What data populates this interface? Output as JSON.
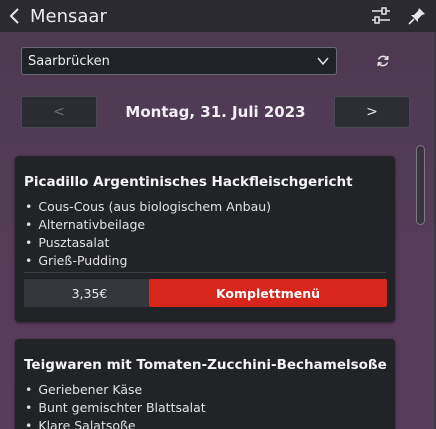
{
  "header": {
    "title": "Mensaar",
    "icons": [
      "chevron-left-icon",
      "sliders-icon",
      "pin-icon"
    ]
  },
  "location": {
    "selected": "Saarbrücken",
    "refresh_icon": "refresh-icon"
  },
  "date_nav": {
    "prev_label": "<",
    "next_label": ">",
    "date": "Montag, 31. Juli 2023"
  },
  "meals": [
    {
      "title": "Picadillo Argentinisches Hackfleischgericht",
      "components": [
        "Cous-Cous (aus biologischem Anbau)",
        "Alternativbeilage",
        "Pusztasalat",
        "Grieß-Pudding"
      ],
      "price": "3,35€",
      "badge": "Komplettmenü",
      "badge_color": "#d9261c"
    },
    {
      "title": "Teigwaren mit Tomaten-Zucchini-Bechamelsoße",
      "components": [
        "Geriebener Käse",
        "Bunt gemischter Blattsalat",
        "Klare Salatsoße"
      ]
    }
  ],
  "colors": {
    "titlebar": "#2b2a31",
    "card": "#212327",
    "accent": "#d9261c"
  }
}
